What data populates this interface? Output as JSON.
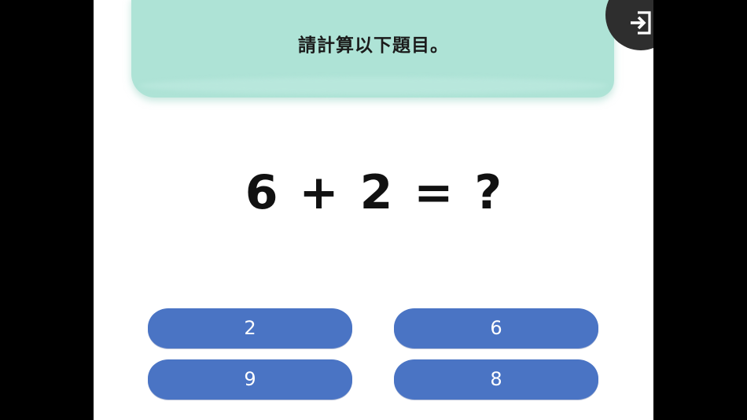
{
  "instruction": "請計算以下題目。",
  "question": {
    "operand1": "6",
    "operator": "+",
    "operand2": "2",
    "equals": "=",
    "unknown": "?"
  },
  "answers": [
    "2",
    "6",
    "9",
    "8"
  ],
  "exit_button": {
    "icon": "exit-icon"
  },
  "colors": {
    "background": "#000000",
    "stage": "#ffffff",
    "banner": "#aee3d6",
    "answer_button": "#4a74c4",
    "exit_button": "#2e2e2e"
  }
}
